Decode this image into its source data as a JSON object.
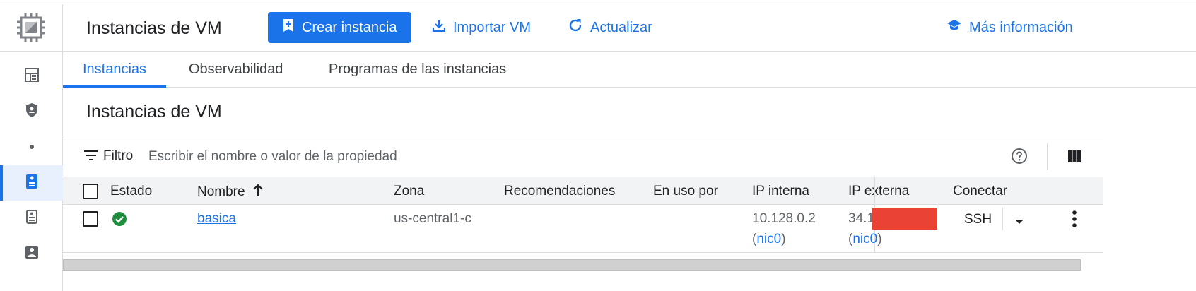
{
  "header": {
    "title": "Instancias de VM",
    "create_label": "Crear instancia",
    "import_label": "Importar VM",
    "refresh_label": "Actualizar",
    "more_info_label": "Más información"
  },
  "tabs": [
    {
      "label": "Instancias",
      "active": true
    },
    {
      "label": "Observabilidad",
      "active": false
    },
    {
      "label": "Programas de las instancias",
      "active": false
    }
  ],
  "section": {
    "title": "Instancias de VM"
  },
  "filter": {
    "label": "Filtro",
    "placeholder": "Escribir el nombre o valor de la propiedad"
  },
  "table": {
    "columns": [
      "Estado",
      "Nombre",
      "Zona",
      "Recomendaciones",
      "En uso por",
      "IP interna",
      "IP externa",
      "Conectar"
    ],
    "sort": {
      "column": "Nombre",
      "direction": "asc"
    },
    "rows": [
      {
        "status": "running",
        "name": "basica",
        "zone": "us-central1-c",
        "recommendations": "",
        "in_use_by": "",
        "internal_ip": "10.128.0.2",
        "internal_nic": "nic0",
        "external_ip": "34.1",
        "external_nic": "nic0",
        "connect": "SSH"
      }
    ]
  },
  "colors": {
    "accent": "#1a73e8",
    "status_ok": "#1e8e3e",
    "redaction": "#ea4335"
  },
  "icons": {
    "logo": "compute-engine-chip-icon",
    "rail": [
      "dashboard-icon",
      "shield-icon",
      "dot-icon",
      "vm-instance-icon",
      "instance-template-icon",
      "sole-tenant-icon"
    ]
  }
}
